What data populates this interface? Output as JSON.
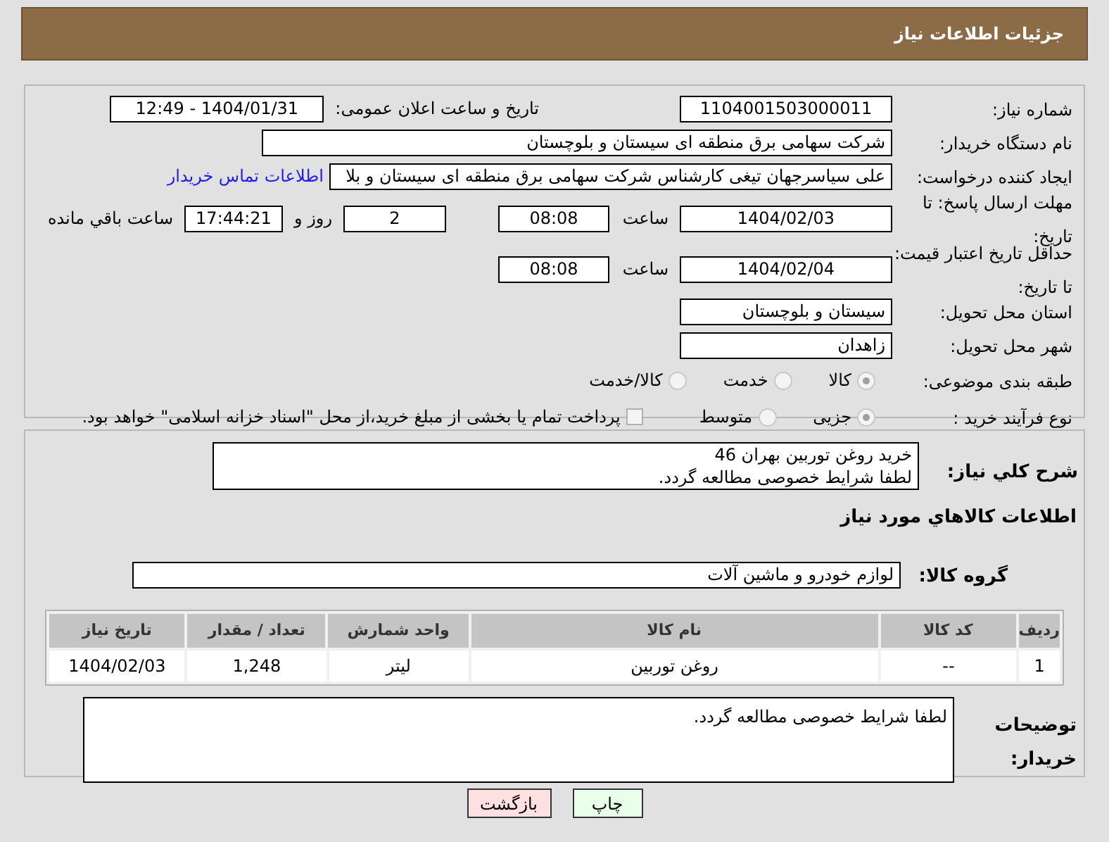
{
  "header": {
    "title": "جزئیات اطلاعات نیاز"
  },
  "need_number": {
    "label": "شماره نیاز:",
    "value": "1104001503000011"
  },
  "announce": {
    "label": "تاریخ و ساعت اعلان عمومی:",
    "value": "1404/01/31 - 12:49"
  },
  "buyer": {
    "label": "نام دستگاه خریدار:",
    "value": "شرکت سهامی برق منطقه ای سیستان و بلوچستان"
  },
  "requester": {
    "label": "ایجاد کننده درخواست:",
    "value": "علی سیاسرجهان تیغی کارشناس شرکت سهامی برق منطقه ای سیستان و بلا",
    "link": "اطلاعات تماس خریدار"
  },
  "deadline": {
    "label": "مهلت ارسال پاسخ: تا تاریخ:",
    "date": "1404/02/03",
    "time_label": "ساعت",
    "time": "08:08",
    "days": "2",
    "days_label": "روز و",
    "remaining": "17:44:21",
    "remaining_label": "ساعت باقي مانده"
  },
  "validity": {
    "label": "حداقل تاریخ اعتبار قیمت: تا تاریخ:",
    "date": "1404/02/04",
    "time_label": "ساعت",
    "time": "08:08"
  },
  "province": {
    "label": "استان محل تحویل:",
    "value": "سیستان و بلوچستان"
  },
  "city": {
    "label": "شهر محل تحویل:",
    "value": "زاهدان"
  },
  "category": {
    "label": "طبقه بندی موضوعی:",
    "options": [
      {
        "label": "کالا",
        "selected": true
      },
      {
        "label": "خدمت",
        "selected": false
      },
      {
        "label": "کالا/خدمت",
        "selected": false
      }
    ]
  },
  "process": {
    "label": "نوع فرآیند خرید :",
    "options": [
      {
        "label": "جزیی",
        "selected": true
      },
      {
        "label": "متوسط",
        "selected": false
      }
    ],
    "treasury": {
      "checked": false,
      "text": "پرداخت تمام یا بخشی از مبلغ خرید،از محل \"اسناد خزانه اسلامی\" خواهد بود."
    }
  },
  "description": {
    "label": "شرح كلي نياز:",
    "lines": [
      "خرید روغن توربین بهران 46",
      "لطفا شرایط خصوصی مطالعه گردد."
    ]
  },
  "goods_heading": "اطلاعات كالاهاي مورد نياز",
  "goods_group": {
    "label": "گروه کالا:",
    "value": "لوازم خودرو و ماشین آلات"
  },
  "table": {
    "columns": [
      "ردیف",
      "کد کالا",
      "نام کالا",
      "واحد شمارش",
      "تعداد / مقدار",
      "تاریخ نیاز"
    ],
    "rows": [
      [
        "1",
        "--",
        "روغن توربین",
        "لیتر",
        "1,248",
        "1404/02/03"
      ]
    ]
  },
  "buyer_notes": {
    "label": "توضیحات خریدار:",
    "value": "لطفا شرایط خصوصی مطالعه گردد."
  },
  "buttons": [
    {
      "label": "چاپ",
      "kind": "print"
    },
    {
      "label": "بازگشت",
      "kind": "back"
    }
  ]
}
